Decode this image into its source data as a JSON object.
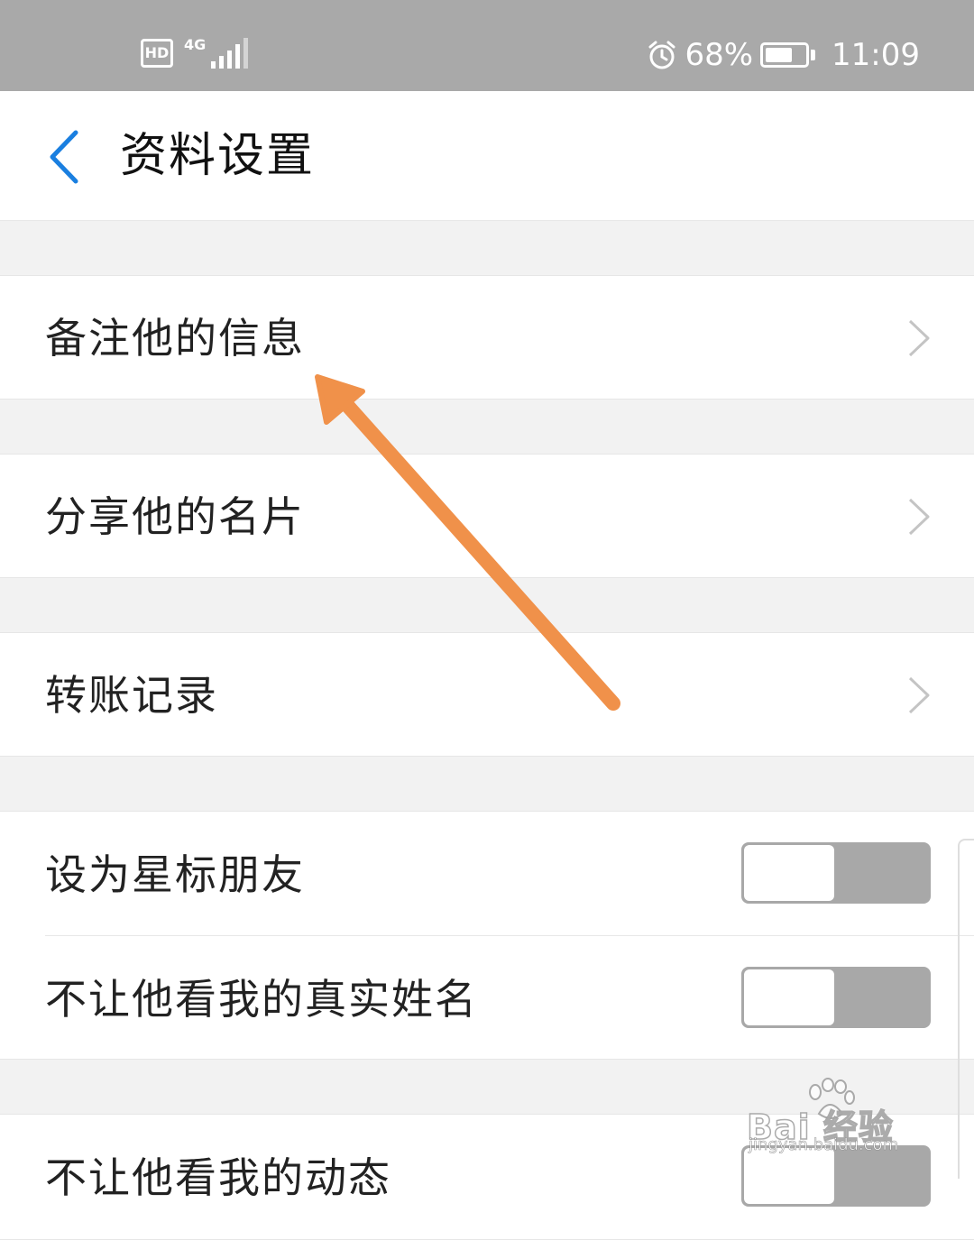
{
  "status_bar": {
    "hd": "HD",
    "network": "4G",
    "battery_percent": "68%",
    "battery_level": 0.68,
    "time": "11:09",
    "icons": [
      "hd-icon",
      "signal-icon",
      "alarm-icon",
      "battery-icon"
    ]
  },
  "header": {
    "title": "资料设置",
    "back_icon": "chevron-left-icon"
  },
  "menu_items": [
    {
      "label": "备注他的信息"
    },
    {
      "label": "分享他的名片"
    },
    {
      "label": "转账记录"
    }
  ],
  "toggles": [
    {
      "label": "设为星标朋友",
      "on": false
    },
    {
      "label": "不让他看我的真实姓名",
      "on": false
    },
    {
      "label": "不让他看我的动态",
      "on": false
    }
  ],
  "watermark": {
    "text": "Bai 经验",
    "url": "jingyan.baidu.com"
  },
  "colors": {
    "accent": "#1a7fe0",
    "status_bar": "#a9a9a9",
    "annotation_arrow": "#f0914a",
    "toggle_off": "#a8a8a8"
  }
}
